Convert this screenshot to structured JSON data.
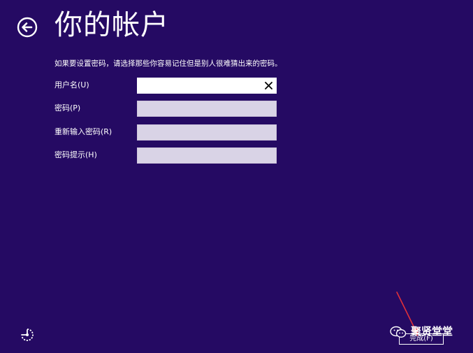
{
  "header": {
    "title": "你的帐户",
    "back_icon": "back-arrow-icon"
  },
  "instruction": "如果要设置密码，请选择那些你容易记住但是别人很难猜出来的密码。",
  "form": {
    "fields": [
      {
        "label": "用户名(U)",
        "value": "",
        "focused": true
      },
      {
        "label": "密码(P)",
        "value": ""
      },
      {
        "label": "重新输入密码(R)",
        "value": ""
      },
      {
        "label": "密码提示(H)",
        "value": ""
      }
    ],
    "clear_icon": "close-icon"
  },
  "footer": {
    "ease_of_access_icon": "ease-of-access-icon",
    "next_label": "完成(F)"
  },
  "watermark": {
    "text": "聚贤堂堂",
    "icon": "wechat-icon"
  },
  "colors": {
    "background": "#250a63",
    "input_bg": "#d9d3e6",
    "annotation_arrow": "#e0303a"
  }
}
